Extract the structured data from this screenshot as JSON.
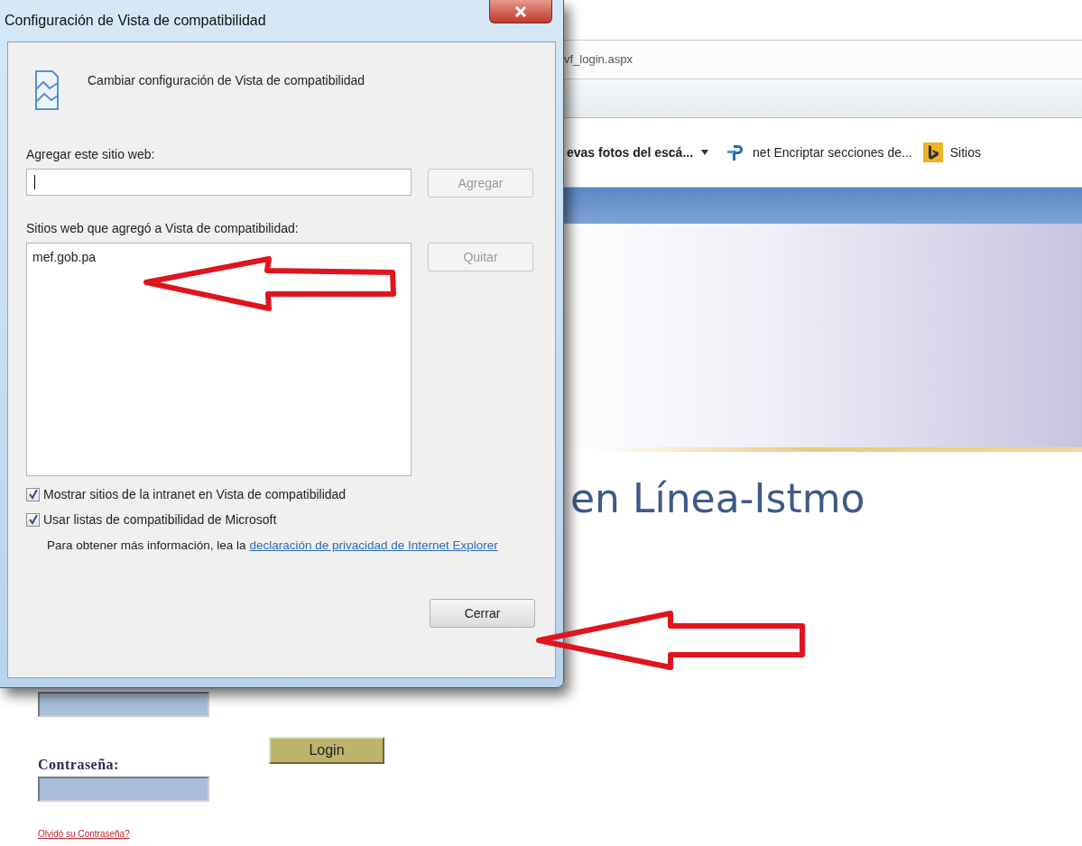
{
  "browser": {
    "address": "vf_login.aspx",
    "favorites": [
      {
        "kind": "feed",
        "label": "evas fotos del escá..."
      },
      {
        "kind": "link",
        "label": "net Encriptar secciones de..."
      },
      {
        "kind": "bing",
        "label": "Sitios"
      }
    ]
  },
  "page": {
    "title": "en Línea-Istmo",
    "password_label": "Contraseña:",
    "login_button": "Login",
    "forgot_link": "Olvidó su Contraseña?"
  },
  "dialog": {
    "title": "Configuración de Vista de compatibilidad",
    "heading": "Cambiar configuración de Vista de compatibilidad",
    "add_label": "Agregar este sitio web:",
    "add_button": {
      "label": "Agregar",
      "disabled": true
    },
    "list_label": "Sitios web que agregó a Vista de compatibilidad:",
    "sites": [
      {
        "label": "mef.gob.pa",
        "selected": false
      }
    ],
    "remove_button": {
      "label": "Quitar",
      "disabled": true
    },
    "options": [
      {
        "label": "Mostrar sitios de la intranet en Vista de compatibilidad",
        "checked": true
      },
      {
        "label": "Usar listas de compatibilidad de Microsoft",
        "checked": true
      }
    ],
    "info": {
      "text": "Para obtener más información, lea la",
      "link": "declaración de privacidad de Internet Explorer"
    },
    "close_button": {
      "label": "Cerrar",
      "disabled": false
    }
  }
}
